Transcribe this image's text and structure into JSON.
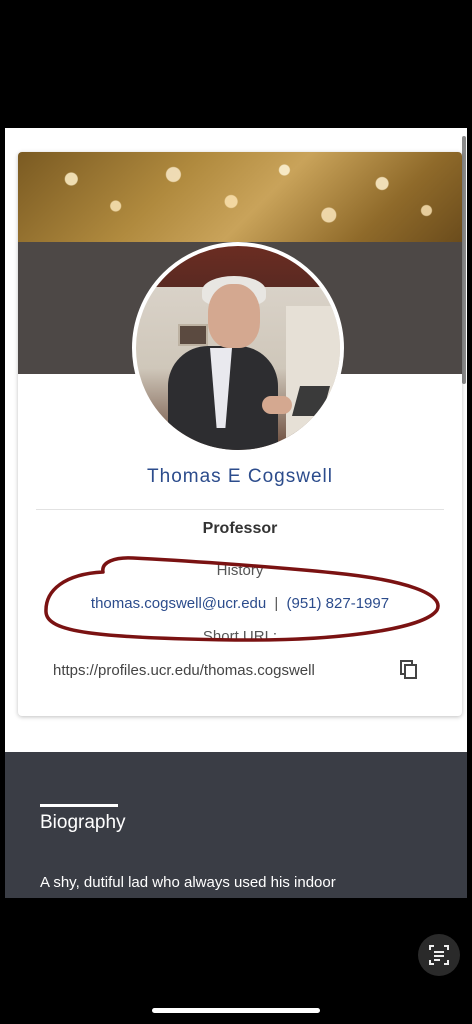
{
  "profile": {
    "name": "Thomas E Cogswell",
    "title": "Professor",
    "history_label": "History",
    "email": "thomas.cogswell@ucr.edu",
    "separator": "|",
    "phone": "(951) 827-1997",
    "short_url_label": "Short URL:",
    "short_url": "https://profiles.ucr.edu/thomas.cogswell"
  },
  "biography": {
    "heading": "Biography",
    "text": "A shy, dutiful lad who always used his indoor"
  },
  "colors": {
    "accent_blue": "#2c4c8c",
    "dark_band": "#4d4846",
    "bio_background": "#3a3d45",
    "annotation_red": "#7a1212"
  },
  "icons": {
    "copy": "copy-icon",
    "lens": "scan-text-icon"
  }
}
